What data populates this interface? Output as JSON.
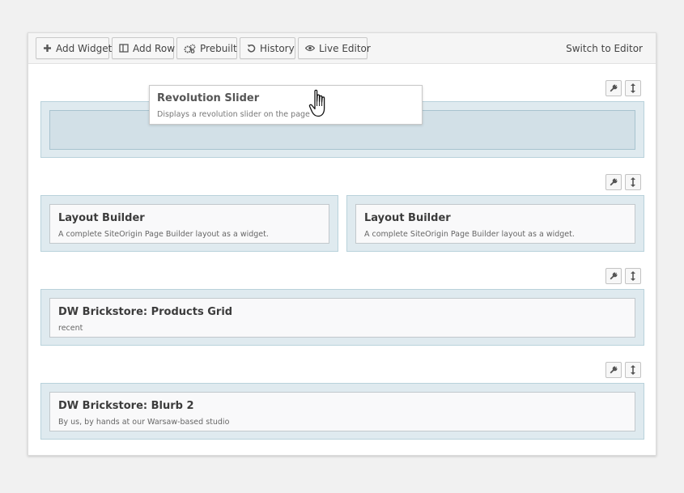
{
  "toolbar": {
    "add_widget": "Add Widget",
    "add_row": "Add Row",
    "prebuilt": "Prebuilt",
    "history": "History",
    "live_editor": "Live Editor",
    "switch_editor": "Switch to Editor"
  },
  "icons": {
    "add": "plus-icon",
    "row": "columns-icon",
    "prebuilt": "cogs-icon",
    "history": "undo-icon",
    "live": "eye-icon",
    "edit_row": "wrench-icon",
    "move_row": "move-vertical-icon",
    "cursor": "hand-cursor-icon"
  },
  "dragging_widget": {
    "title": "Revolution Slider",
    "description": "Displays a revolution slider on the page"
  },
  "rows": [
    {
      "cells": []
    },
    {
      "cells": [
        {
          "title": "Layout Builder",
          "description": "A complete SiteOrigin Page Builder layout as a widget."
        },
        {
          "title": "Layout Builder",
          "description": "A complete SiteOrigin Page Builder layout as a widget."
        }
      ]
    },
    {
      "cells": [
        {
          "title": "DW Brickstore: Products Grid",
          "description": "recent"
        }
      ]
    },
    {
      "cells": [
        {
          "title": "DW Brickstore: Blurb 2",
          "description": "By us, by hands at our Warsaw-based studio"
        }
      ]
    }
  ],
  "colors": {
    "row_background": "#dfeaef",
    "row_border": "#b9d2db",
    "widget_background": "#f9f9fa"
  }
}
